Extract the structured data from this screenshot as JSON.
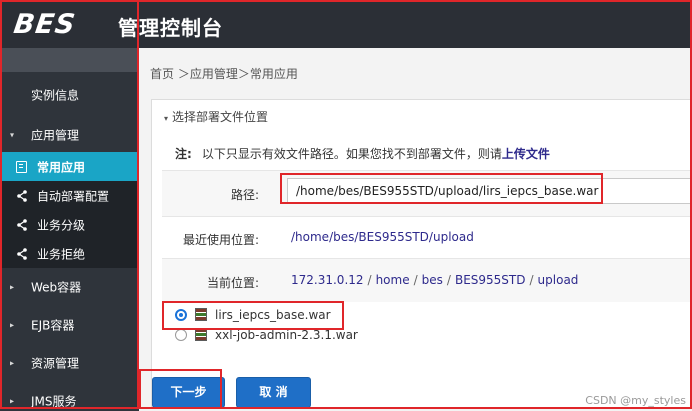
{
  "header": {
    "logo": "BES",
    "title": "管理控制台"
  },
  "sidebar": {
    "items": [
      {
        "label": "实例信息"
      },
      {
        "label": "应用管理",
        "arrow": "▾"
      },
      {
        "label": "常用应用",
        "active": true
      },
      {
        "label": "自动部署配置"
      },
      {
        "label": "业务分级"
      },
      {
        "label": "业务拒绝"
      },
      {
        "label": "Web容器",
        "arrow": "▸"
      },
      {
        "label": "EJB容器",
        "arrow": "▸"
      },
      {
        "label": "资源管理",
        "arrow": "▸"
      },
      {
        "label": "JMS服务",
        "arrow": "▸"
      }
    ]
  },
  "breadcrumb": "首页 ＞应用管理＞常用应用",
  "panel": {
    "heading": "选择部署文件位置",
    "caret": "▾",
    "note_label": "注:",
    "note_text": "以下只显示有效文件路径。如果您找不到部署文件，则请",
    "note_link": "上传文件",
    "path_label": "路径:",
    "path_value": "/home/bes/BES955STD/upload/lirs_iepcs_base.war",
    "recent_label": "最近使用位置:",
    "recent_value": "/home/bes/BES955STD/upload",
    "current_label": "当前位置:",
    "current_parts": [
      "172.31.0.12",
      "home",
      "bes",
      "BES955STD",
      "upload"
    ],
    "current_sep": "/",
    "files": [
      {
        "name": "lirs_iepcs_base.war",
        "checked": true
      },
      {
        "name": "xxl-job-admin-2.3.1.war",
        "checked": false
      }
    ]
  },
  "buttons": {
    "next": "下一步",
    "cancel": "取 消"
  },
  "watermark": "CSDN @my_styles",
  "colors": {
    "header_bg": "#2b2f36",
    "sidebar_bg": "#2f343b",
    "active_item": "#1aa5c6",
    "button": "#1f6fc7",
    "link": "#2e2a8c",
    "highlight": "#e0262a"
  }
}
